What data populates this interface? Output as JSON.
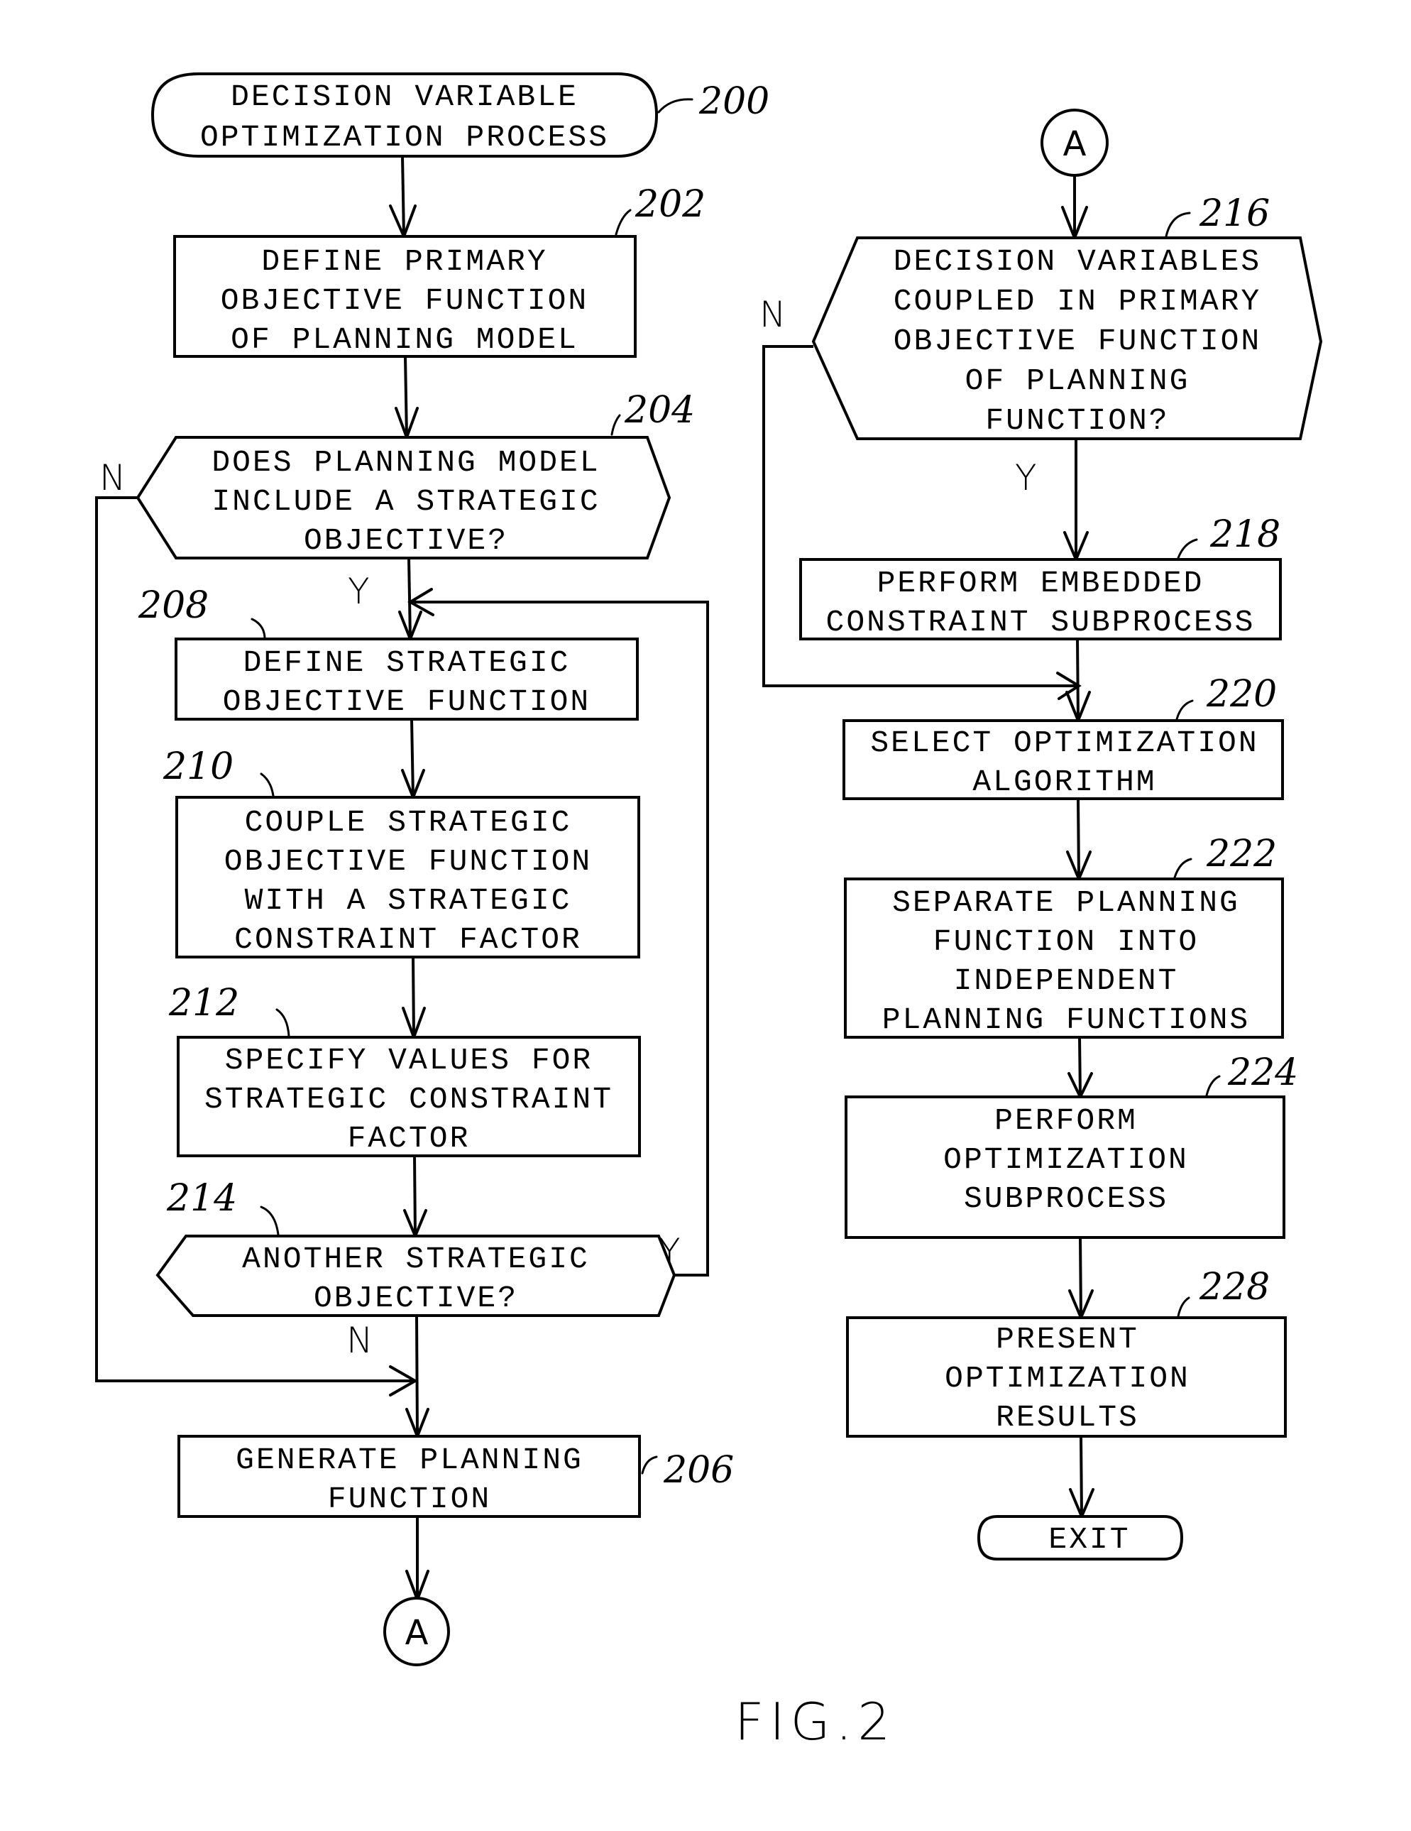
{
  "figure_label": "FIG.2",
  "connector_label": "A",
  "branch_labels": {
    "yes": "Y",
    "no": "N"
  },
  "nodes": {
    "n200": {
      "ref": "200",
      "type": "terminal",
      "lines": [
        "DECISION VARIABLE",
        "OPTIMIZATION PROCESS"
      ]
    },
    "n202": {
      "ref": "202",
      "type": "process",
      "lines": [
        "DEFINE PRIMARY",
        "OBJECTIVE FUNCTION",
        "OF PLANNING MODEL"
      ]
    },
    "n204": {
      "ref": "204",
      "type": "decision",
      "lines": [
        "DOES PLANNING MODEL",
        "INCLUDE A STRATEGIC",
        "OBJECTIVE?"
      ]
    },
    "n208": {
      "ref": "208",
      "type": "process",
      "lines": [
        "DEFINE STRATEGIC",
        "OBJECTIVE FUNCTION"
      ]
    },
    "n210": {
      "ref": "210",
      "type": "process",
      "lines": [
        "COUPLE STRATEGIC",
        "OBJECTIVE FUNCTION",
        "WITH A STRATEGIC",
        "CONSTRAINT FACTOR"
      ]
    },
    "n212": {
      "ref": "212",
      "type": "process",
      "lines": [
        "SPECIFY VALUES FOR",
        "STRATEGIC CONSTRAINT",
        "FACTOR"
      ]
    },
    "n214": {
      "ref": "214",
      "type": "decision",
      "lines": [
        "ANOTHER STRATEGIC",
        "OBJECTIVE?"
      ]
    },
    "n206": {
      "ref": "206",
      "type": "process",
      "lines": [
        "GENERATE PLANNING",
        "FUNCTION"
      ]
    },
    "n216": {
      "ref": "216",
      "type": "decision",
      "lines": [
        "DECISION VARIABLES",
        "COUPLED IN PRIMARY",
        "OBJECTIVE FUNCTION",
        "OF PLANNING",
        "FUNCTION?"
      ]
    },
    "n218": {
      "ref": "218",
      "type": "process",
      "lines": [
        "PERFORM EMBEDDED",
        "CONSTRAINT SUBPROCESS"
      ]
    },
    "n220": {
      "ref": "220",
      "type": "process",
      "lines": [
        "SELECT OPTIMIZATION",
        "ALGORITHM"
      ]
    },
    "n222": {
      "ref": "222",
      "type": "process",
      "lines": [
        "SEPARATE PLANNING",
        "FUNCTION INTO",
        "INDEPENDENT",
        "PLANNING FUNCTIONS"
      ]
    },
    "n224": {
      "ref": "224",
      "type": "process",
      "lines": [
        "PERFORM",
        "OPTIMIZATION",
        "SUBPROCESS"
      ]
    },
    "n228": {
      "ref": "228",
      "type": "process",
      "lines": [
        "PRESENT",
        "OPTIMIZATION",
        "RESULTS"
      ]
    },
    "exit": {
      "type": "terminal",
      "lines": [
        "EXIT"
      ]
    }
  }
}
